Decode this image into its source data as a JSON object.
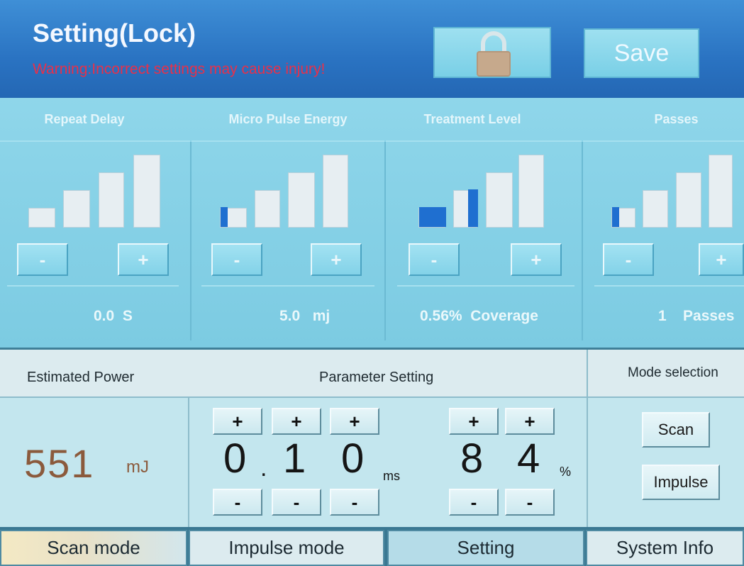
{
  "header": {
    "title": "Setting(Lock)",
    "warning": "Warning:Incorrect settings may cause injury!",
    "save_label": "Save",
    "lock_icon": "padlock-icon"
  },
  "panels": [
    {
      "title": "Repeat Delay",
      "level": 0,
      "minus": "-",
      "plus": "+",
      "value": "0.0",
      "unit": "S"
    },
    {
      "title": "Micro Pulse Energy",
      "level": 0.25,
      "minus": "-",
      "plus": "+",
      "value": "5.0",
      "unit": "mj"
    },
    {
      "title": "Treatment Level",
      "level": 0.5,
      "minus": "-",
      "plus": "+",
      "value": "0.56%",
      "unit": "Coverage"
    },
    {
      "title": "Passes",
      "level": 0.25,
      "minus": "-",
      "plus": "+",
      "value": "1",
      "unit": "Passes"
    }
  ],
  "estimated_power": {
    "title": "Estimated Power",
    "value": "551",
    "unit": "mJ"
  },
  "parameter_setting": {
    "title": "Parameter Setting",
    "time_digits": [
      "0",
      "1",
      "0"
    ],
    "time_unit": "ms",
    "percent_digits": [
      "8",
      "4"
    ],
    "percent_unit": "%",
    "plus": "+",
    "minus": "-"
  },
  "mode_selection": {
    "title": "Mode selection",
    "scan": "Scan",
    "impulse": "Impulse"
  },
  "tabs": [
    "Scan mode",
    "Impulse mode",
    "Setting",
    "System Info"
  ],
  "colors": {
    "accent": "#2a73c2",
    "warning": "#e8304a",
    "bar_fill": "#1f6fd0"
  }
}
